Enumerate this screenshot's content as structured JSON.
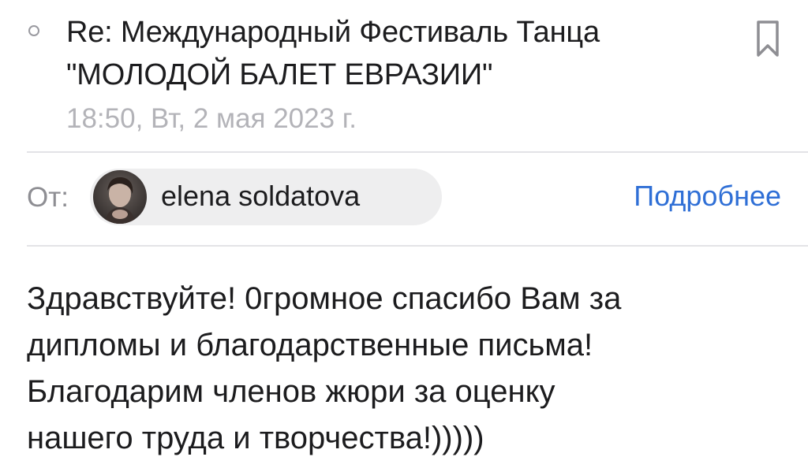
{
  "message": {
    "subject": "Re: Международный Фестиваль Танца \"МОЛОДОЙ БАЛЕТ ЕВРАЗИИ\"",
    "date": "18:50, Вт, 2 мая 2023 г.",
    "from_label": "От:",
    "sender_name": "elena soldatova",
    "details_link": "Подробнее",
    "body_lines": [
      "Здравствуйте! 0громное  спасибо Вам за",
      "дипломы и благодарственные письма!",
      "Благодарим членов жюри за оценку",
      "нашего труда и творчества!)))))"
    ]
  },
  "icons": {
    "unread": "unread-circle-icon",
    "bookmark": "bookmark-icon",
    "avatar": "sender-avatar"
  },
  "colors": {
    "link": "#2f6fd6",
    "secondary_text": "#8e8e93",
    "date_text": "#b3b3b8",
    "chip_bg": "#eeeeef"
  }
}
